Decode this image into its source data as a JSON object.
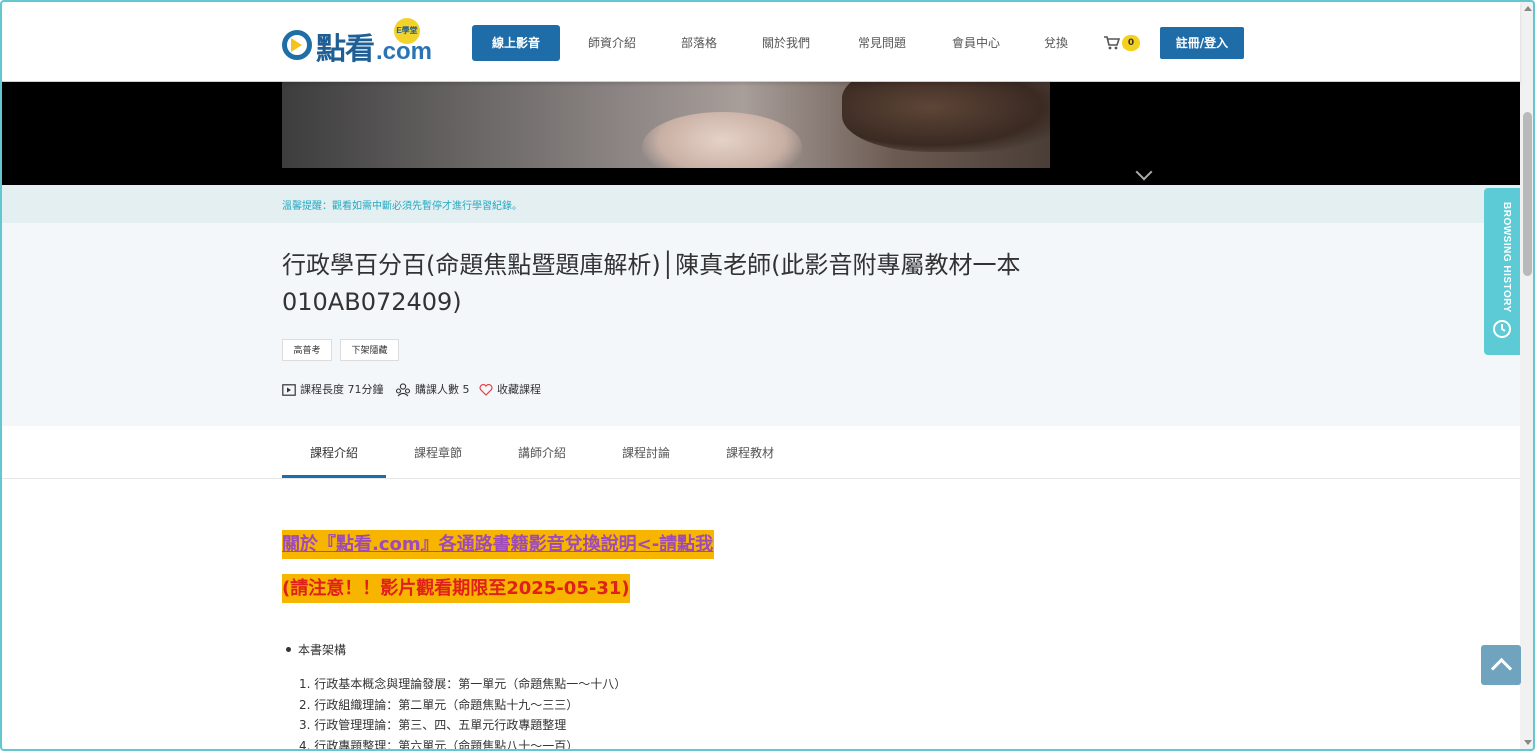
{
  "brand": {
    "logo_text": "點看",
    "logo_domain": ".com",
    "logo_badge": "E學堂"
  },
  "nav": {
    "items": [
      {
        "label": "線上影音",
        "active": true
      },
      {
        "label": "師資介紹"
      },
      {
        "label": "部落格"
      },
      {
        "label": "關於我們"
      },
      {
        "label": "常見問題"
      },
      {
        "label": "會員中心"
      },
      {
        "label": "兌換"
      }
    ],
    "cart_count": "0",
    "login_label": "註冊/登入"
  },
  "notice": {
    "text": "溫馨提醒：觀看如需中斷必須先暫停才進行學習紀錄。"
  },
  "course": {
    "title": "行政學百分百(命題焦點暨題庫解析)│陳真老師(此影音附專屬教材一本010AB072409)",
    "tags": [
      "高普考",
      "下架隱藏"
    ],
    "length_label": "課程長度 71分鐘",
    "buyers_label": "購課人數 5",
    "favorite_label": "收藏課程"
  },
  "tabs": [
    {
      "label": "課程介紹",
      "active": true
    },
    {
      "label": "課程章節"
    },
    {
      "label": "講師介紹"
    },
    {
      "label": "課程討論"
    },
    {
      "label": "課程教材"
    }
  ],
  "content": {
    "link_text": "關於『點看.com』各通路書籍影音兌換說明<-請點我",
    "warning_text": "(請注意！！影片觀看期限至2025-05-31)",
    "bullet_item": "本書架構",
    "list_items": [
      "行政基本概念與理論發展：第一單元（命題焦點一～十八）",
      "行政組織理論：第二單元（命題焦點十九～三三）",
      "行政管理理論：第三、四、五單元行政專題整理",
      "行政專題整理：第六單元（命題焦點八十～一百）"
    ]
  },
  "side": {
    "history_label": "BROWSING HISTORY"
  },
  "colors": {
    "primary": "#1f6da8",
    "accent_teal": "#5dcbd5",
    "highlight": "#f7b500",
    "link_purple": "#9e4bb7",
    "warning_red": "#e0201b"
  }
}
